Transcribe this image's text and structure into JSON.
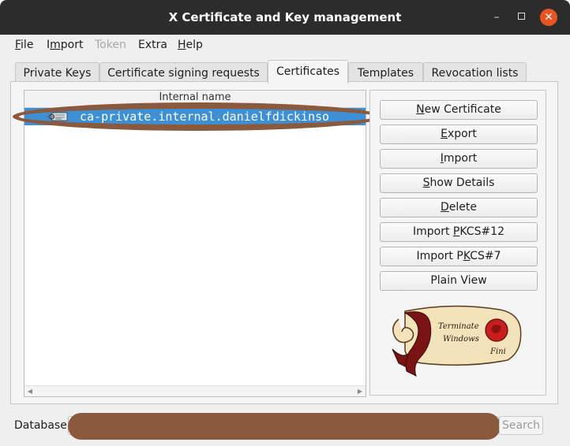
{
  "window": {
    "title": "X Certificate and Key management",
    "controls": {
      "minimize": "–",
      "close": "✕"
    }
  },
  "menubar": {
    "file": {
      "first": "F",
      "rest": "ile"
    },
    "import": {
      "pre": "I",
      "u": "m",
      "post": "port"
    },
    "token": "Token",
    "extra": "Extra",
    "help": {
      "first": "H",
      "rest": "elp"
    }
  },
  "tabs": [
    "Private Keys",
    "Certificate signing requests",
    "Certificates",
    "Templates",
    "Revocation lists"
  ],
  "active_tab": "Certificates",
  "tree": {
    "column_header": "Internal name",
    "rows": [
      {
        "name": "ca-private.internal.danielfdickinso",
        "icon": "certificate-icon",
        "selected": true
      }
    ]
  },
  "buttons": {
    "new_certificate": {
      "u": "N",
      "rest": "ew Certificate"
    },
    "export": {
      "u": "E",
      "rest": "xport"
    },
    "import": {
      "u": "I",
      "rest": "mport"
    },
    "show_details": {
      "u": "S",
      "rest": "how Details"
    },
    "delete": {
      "u": "D",
      "rest": "elete"
    },
    "import_pkcs12": {
      "pre": "Import ",
      "u": "P",
      "post": "KCS#12"
    },
    "import_pkcs7": {
      "pre": "Import P",
      "u": "K",
      "post": "CS#7"
    },
    "plain_view": "Plain View"
  },
  "seal_image": {
    "icon": "scroll-seal-logo",
    "text_line1": "Terminate",
    "text_line2": "Windows",
    "text_line3": "Fini"
  },
  "statusbar": {
    "database_label": "Database:",
    "database_path": "",
    "search_label": "Search"
  },
  "colors": {
    "titlebar": "#2c2c2c",
    "close_button": "#e95420",
    "selection": "#3d8fd6",
    "redaction": "#8b5a3e"
  }
}
